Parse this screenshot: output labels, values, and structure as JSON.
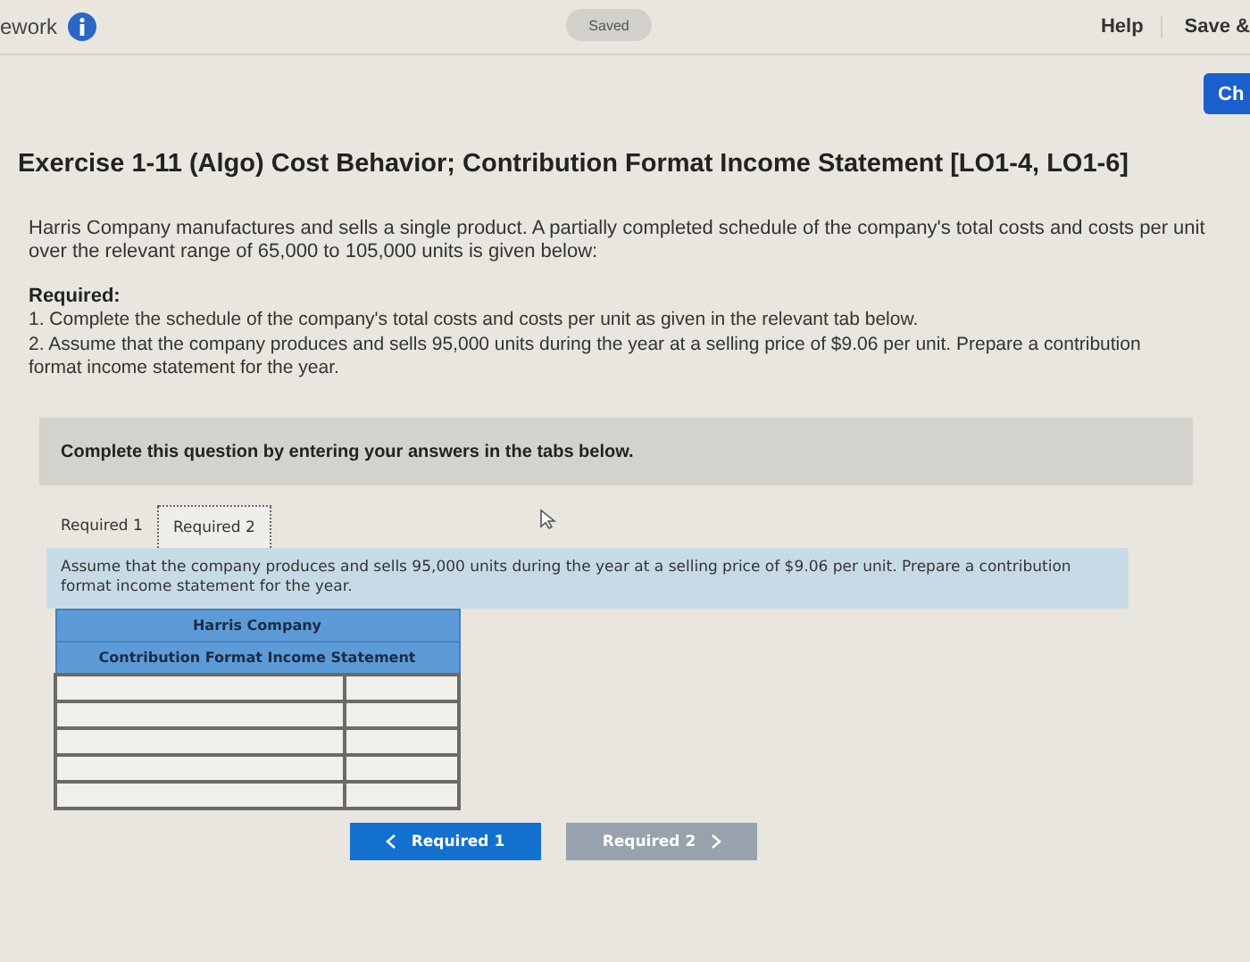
{
  "top_bar": {
    "app_name": "ework",
    "status": "Saved",
    "help": "Help",
    "save": "Save &",
    "check_button": "Ch"
  },
  "exercise": {
    "title": "Exercise 1-11 (Algo) Cost Behavior; Contribution Format Income Statement [LO1-4, LO1-6]",
    "intro": "Harris Company manufactures and sells a single product. A partially completed schedule of the company's total costs and costs per unit over the relevant range of 65,000 to 105,000 units is given below:",
    "required_heading": "Required:",
    "required_items": [
      "1. Complete the schedule of the company's total costs and costs per unit as given in the relevant tab below.",
      "2. Assume that the company produces and sells 95,000 units during the year at a selling price of $9.06 per unit. Prepare a contribution format income statement for the year."
    ]
  },
  "question_panel": {
    "instruction": "Complete this question by entering your answers in the tabs below.",
    "tabs": [
      {
        "label": "Required 1",
        "selected": false
      },
      {
        "label": "Required 2",
        "selected": true
      }
    ],
    "prompt": "Assume that the company produces and sells 95,000 units during the year at a selling price of $9.06 per unit. Prepare a contribution format income statement for the year.",
    "table": {
      "company": "Harris Company",
      "statement": "Contribution Format Income Statement",
      "rows": [
        {
          "kind": "entry"
        },
        {
          "kind": "entry"
        },
        {
          "kind": "entry"
        },
        {
          "kind": "entry"
        },
        {
          "kind": "entry"
        }
      ]
    },
    "nav": [
      {
        "label": "Required 1",
        "kind": "prev",
        "disabled": false
      },
      {
        "label": "Required 2",
        "kind": "next",
        "disabled": true
      }
    ]
  }
}
